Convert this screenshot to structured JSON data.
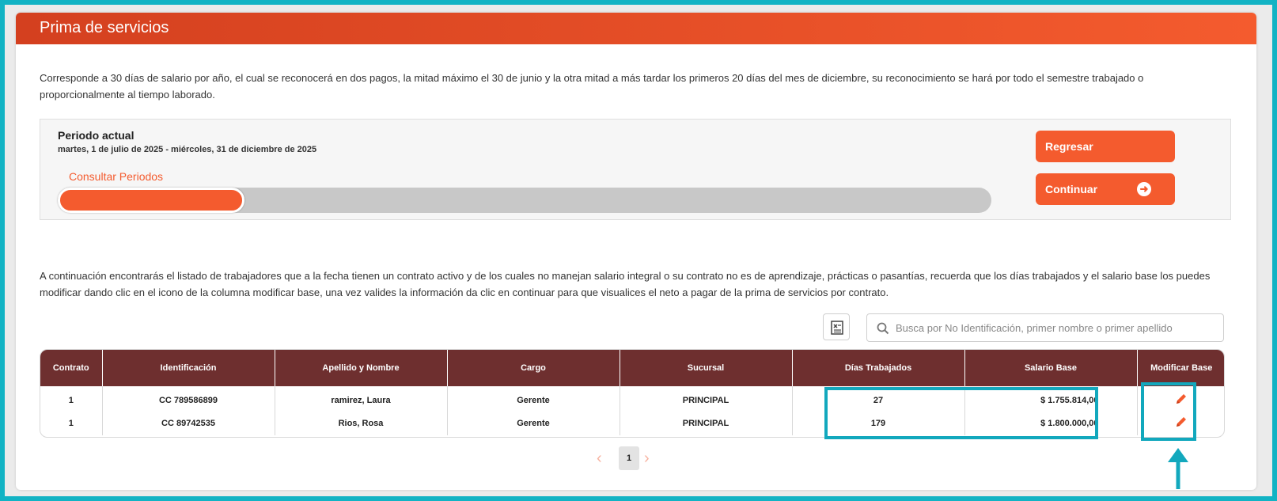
{
  "header": {
    "title": "Prima de servicios"
  },
  "intro_text": "Corresponde a 30 días de salario por año, el cual se reconocerá en dos pagos, la mitad máximo el 30 de junio y la otra mitad a más tardar los primeros 20 días del mes de diciembre, su reconocimiento se hará por todo el semestre trabajado o proporcionalmente al tiempo laborado.",
  "period": {
    "label": "Periodo actual",
    "range": "martes, 1 de julio de 2025 - miércoles, 31 de diciembre de 2025",
    "consult_link": "Consultar Periodos",
    "progress_fraction": 0.2
  },
  "buttons": {
    "back": "Regresar",
    "next": "Continuar"
  },
  "list_intro": "A continuación encontrarás el listado de trabajadores que a la fecha tienen un contrato activo y de los cuales no manejan salario integral o su contrato no es de aprendizaje, prácticas o pasantías, recuerda que los días trabajados y el salario base los puedes modificar dando clic en el icono de la columna modificar base, una vez valides la información da clic en continuar para que visualices el neto a pagar de la prima de servicios por contrato.",
  "search": {
    "placeholder": "Busca por No Identificación, primer nombre o primer apellido",
    "value": ""
  },
  "table": {
    "headers": {
      "contrato": "Contrato",
      "identificacion": "Identificación",
      "nombre": "Apellido y Nombre",
      "cargo": "Cargo",
      "sucursal": "Sucursal",
      "dias": "Días Trabajados",
      "salario": "Salario Base",
      "modificar": "Modificar Base"
    },
    "rows": [
      {
        "contrato": "1",
        "identificacion": "CC 789586899",
        "nombre": "ramirez, Laura",
        "cargo": "Gerente",
        "sucursal": "PRINCIPAL",
        "dias": "27",
        "salario": "$ 1.755.814,00"
      },
      {
        "contrato": "1",
        "identificacion": "CC 89742535",
        "nombre": "Rios, Rosa",
        "cargo": "Gerente",
        "sucursal": "PRINCIPAL",
        "dias": "179",
        "salario": "$ 1.800.000,00"
      }
    ]
  },
  "pagination": {
    "current_page": "1",
    "prev_icon": "chevron-left",
    "next_icon": "chevron-right"
  },
  "colors": {
    "accent": "#f45b2e",
    "table_header": "#6e2f2f",
    "highlight": "#12a8bd",
    "frame": "#12b3c4"
  }
}
